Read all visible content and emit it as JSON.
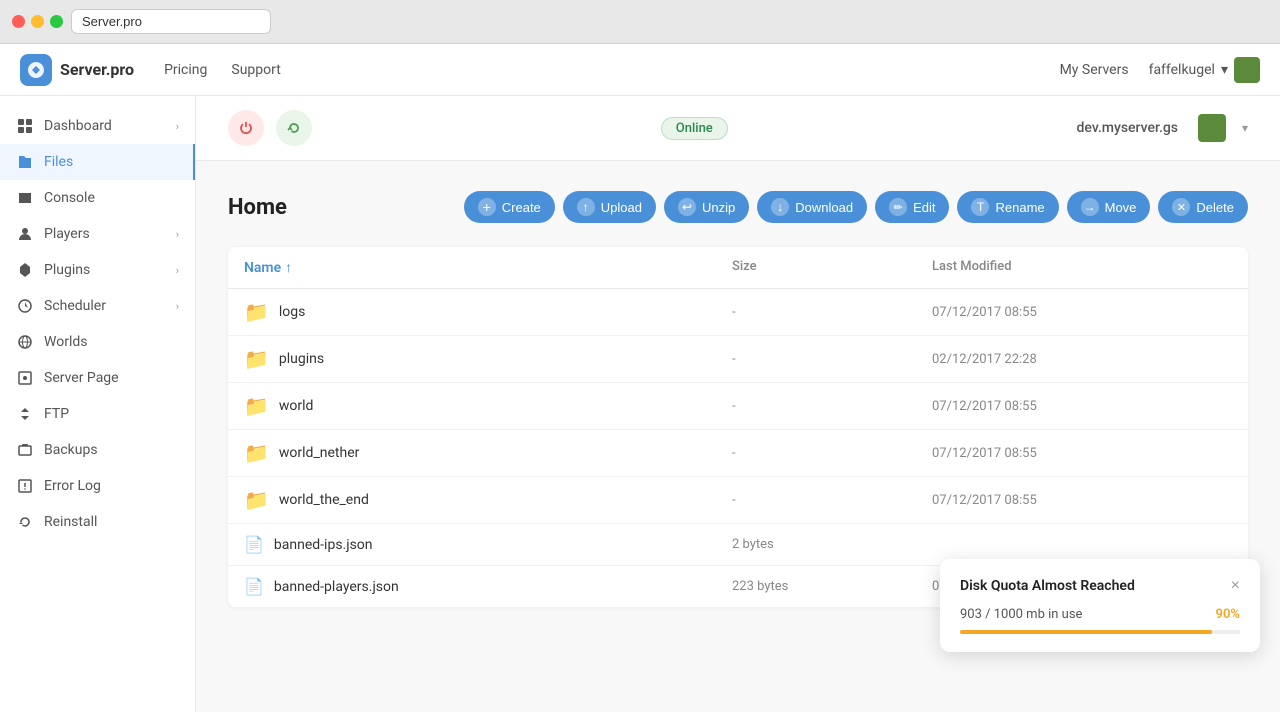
{
  "titlebar": {
    "address": "Server.pro"
  },
  "navbar": {
    "logo_text": "Server.pro",
    "links": [
      "Pricing",
      "Support"
    ],
    "right_links": [
      "My Servers"
    ],
    "user_name": "faffelkugel"
  },
  "sidebar": {
    "items": [
      {
        "id": "dashboard",
        "label": "Dashboard",
        "has_chevron": true,
        "active": false
      },
      {
        "id": "files",
        "label": "Files",
        "has_chevron": false,
        "active": true
      },
      {
        "id": "console",
        "label": "Console",
        "has_chevron": false,
        "active": false
      },
      {
        "id": "players",
        "label": "Players",
        "has_chevron": true,
        "active": false
      },
      {
        "id": "plugins",
        "label": "Plugins",
        "has_chevron": true,
        "active": false
      },
      {
        "id": "scheduler",
        "label": "Scheduler",
        "has_chevron": true,
        "active": false
      },
      {
        "id": "worlds",
        "label": "Worlds",
        "has_chevron": false,
        "active": false
      },
      {
        "id": "server-page",
        "label": "Server Page",
        "has_chevron": false,
        "active": false
      },
      {
        "id": "ftp",
        "label": "FTP",
        "has_chevron": false,
        "active": false
      },
      {
        "id": "backups",
        "label": "Backups",
        "has_chevron": false,
        "active": false
      },
      {
        "id": "error-log",
        "label": "Error Log",
        "has_chevron": false,
        "active": false
      },
      {
        "id": "reinstall",
        "label": "Reinstall",
        "has_chevron": false,
        "active": false
      }
    ]
  },
  "statusbar": {
    "status": "Online",
    "server_address": "dev.myserver.gs"
  },
  "filemanager": {
    "title": "Home",
    "actions": [
      {
        "id": "create",
        "label": "Create",
        "icon": "+"
      },
      {
        "id": "upload",
        "label": "Upload",
        "icon": "↑"
      },
      {
        "id": "unzip",
        "label": "Unzip",
        "icon": "↩"
      },
      {
        "id": "download",
        "label": "Download",
        "icon": "↓"
      },
      {
        "id": "edit",
        "label": "Edit",
        "icon": "✏"
      },
      {
        "id": "rename",
        "label": "Rename",
        "icon": "T"
      },
      {
        "id": "move",
        "label": "Move",
        "icon": "→"
      },
      {
        "id": "delete",
        "label": "Delete",
        "icon": "✕"
      }
    ],
    "columns": [
      {
        "label": "Name",
        "sort": "asc"
      },
      {
        "label": "Size"
      },
      {
        "label": "Last Modified"
      }
    ],
    "files": [
      {
        "name": "logs",
        "type": "folder",
        "size": "-",
        "modified": "07/12/2017 08:55"
      },
      {
        "name": "plugins",
        "type": "folder",
        "size": "-",
        "modified": "02/12/2017 22:28"
      },
      {
        "name": "world",
        "type": "folder",
        "size": "-",
        "modified": "07/12/2017 08:55"
      },
      {
        "name": "world_nether",
        "type": "folder",
        "size": "-",
        "modified": "07/12/2017 08:55"
      },
      {
        "name": "world_the_end",
        "type": "folder",
        "size": "-",
        "modified": "07/12/2017 08:55"
      },
      {
        "name": "banned-ips.json",
        "type": "file",
        "size": "2 bytes",
        "modified": ""
      },
      {
        "name": "banned-players.json",
        "type": "file",
        "size": "223 bytes",
        "modified": "07/12/2017 08:55"
      }
    ]
  },
  "toast": {
    "title": "Disk Quota Almost Reached",
    "info": "903 / 1000 mb in use",
    "percent": "90%",
    "fill_width": 90
  }
}
